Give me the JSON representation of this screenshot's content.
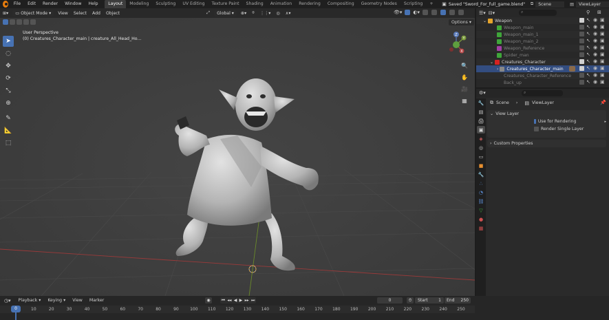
{
  "menu": [
    "File",
    "Edit",
    "Render",
    "Window",
    "Help"
  ],
  "workspaces": [
    "Layout",
    "Modeling",
    "Sculpting",
    "UV Editing",
    "Texture Paint",
    "Shading",
    "Animation",
    "Rendering",
    "Compositing",
    "Geometry Nodes",
    "Scripting"
  ],
  "active_workspace": "Layout",
  "add_workspace": "+",
  "file_status": "Saved \"Sword_For_full_game.blend\"",
  "scene_name": "Scene",
  "view_layer_name": "ViewLayer",
  "viewport": {
    "mode": "Object Mode",
    "menus": [
      "View",
      "Select",
      "Add",
      "Object"
    ],
    "transform_orientation": "Global",
    "options_label": "Options",
    "overlay_title": "User Perspective",
    "overlay_subtitle": "(0) Creatures_Character_main | creature_All_Head_Ho...",
    "gizmo_axes": [
      "Z",
      "Y",
      "X"
    ]
  },
  "outliner": {
    "search_placeholder": "",
    "rows": [
      {
        "name": "Weapon",
        "color": "#e6a42b",
        "dim": false
      },
      {
        "name": "Weapon_main",
        "color": "#3fa63a",
        "dim": true
      },
      {
        "name": "Weapon_main_1",
        "color": "#3fa63a",
        "dim": true
      },
      {
        "name": "Weapon_main_2",
        "color": "#3fa63a",
        "dim": true
      },
      {
        "name": "Weapon_Reference",
        "color": "#a33fa6",
        "dim": true
      },
      {
        "name": "Spider_man",
        "color": "#3fa63a",
        "dim": true
      },
      {
        "name": "Creatures_Character",
        "color": "#d42222",
        "dim": false
      },
      {
        "name": "Creatures_Character_main",
        "color": "#888888",
        "dim": false
      },
      {
        "name": "Creatures_Character_Reference",
        "color": "#888888",
        "dim": true
      },
      {
        "name": "Back_up",
        "color": "#888888",
        "dim": true
      }
    ]
  },
  "properties": {
    "search_placeholder": "",
    "breadcrumb_scene": "Scene",
    "breadcrumb_layer": "ViewLayer",
    "panel_view_layer": "View Layer",
    "use_for_rendering": "Use for Rendering",
    "use_for_rendering_checked": true,
    "render_single_layer": "Render Single Layer",
    "render_single_layer_checked": false,
    "custom_properties": "Custom Properties"
  },
  "timeline": {
    "menus": [
      "Playback",
      "Keying",
      "View",
      "Marker"
    ],
    "current_frame": "0",
    "start_label": "Start",
    "start_value": "1",
    "end_label": "End",
    "end_value": "250",
    "ticks": [
      "0",
      "10",
      "20",
      "30",
      "40",
      "50",
      "60",
      "70",
      "80",
      "90",
      "100",
      "110",
      "120",
      "130",
      "140",
      "150",
      "160",
      "170",
      "180",
      "190",
      "200",
      "210",
      "220",
      "230",
      "240",
      "250"
    ]
  }
}
